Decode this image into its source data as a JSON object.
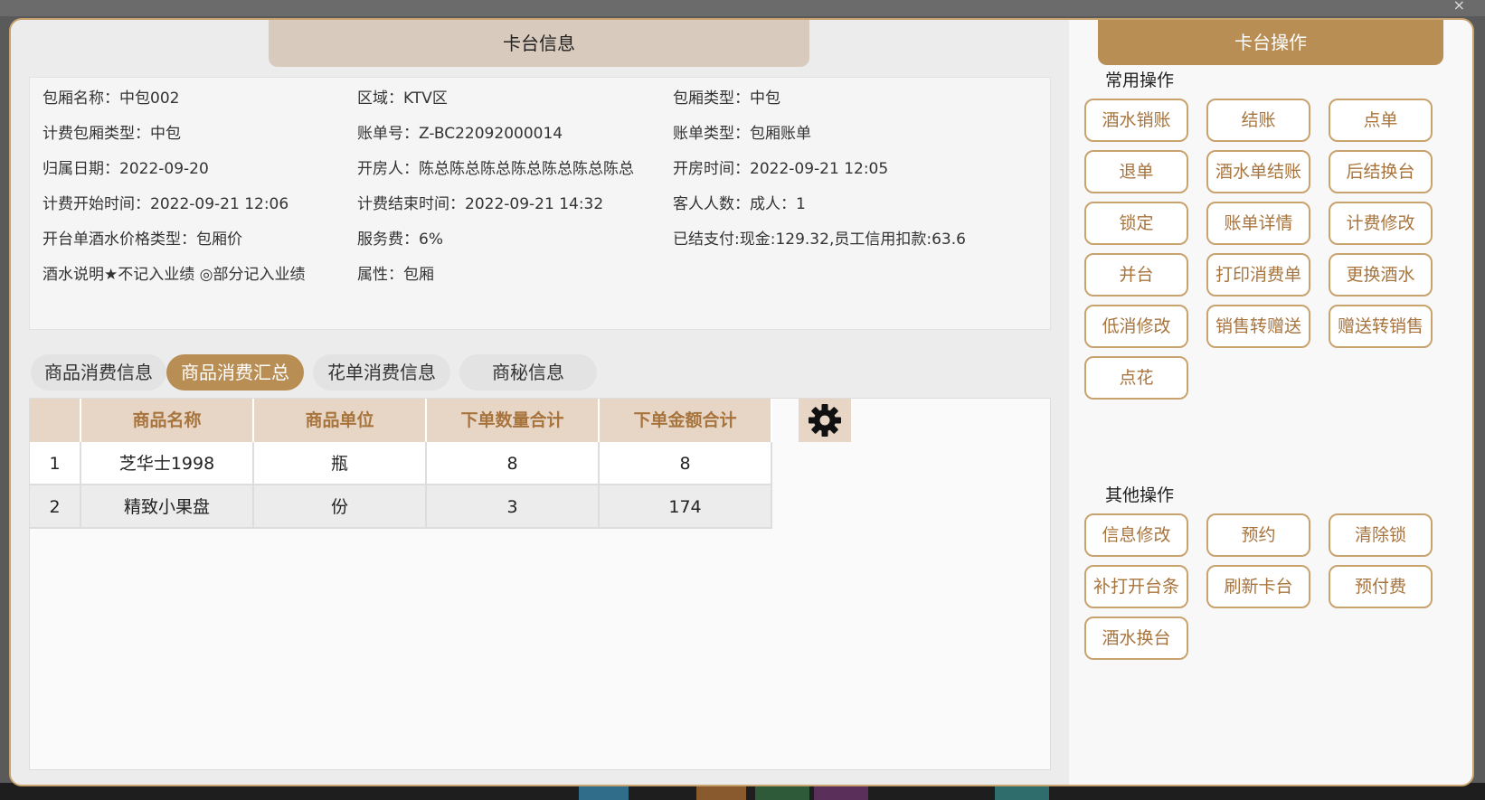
{
  "dialog": {
    "left_title": "卡台信息",
    "right_title": "卡台操作"
  },
  "info": [
    [
      "包厢名称：中包002",
      "区域：KTV区",
      "包厢类型：中包"
    ],
    [
      "计费包厢类型：中包",
      "账单号：Z-BC22092000014",
      "账单类型：包厢账单"
    ],
    [
      "归属日期：2022-09-20",
      "开房人：陈总陈总陈总陈总陈总陈总陈总",
      "开房时间：2022-09-21 12:05"
    ],
    [
      "计费开始时间：2022-09-21 12:06",
      "计费结束时间：2022-09-21 14:32",
      "客人人数：成人：1"
    ],
    [
      "开台单酒水价格类型：包厢价",
      "服务费：6%",
      "已结支付:现金:129.32,员工信用扣款:63.6"
    ],
    [
      "酒水说明★不记入业绩 ◎部分记入业绩",
      "属性：包厢",
      ""
    ]
  ],
  "tabs": [
    {
      "label": "商品消费信息",
      "active": false
    },
    {
      "label": "商品消费汇总",
      "active": true
    },
    {
      "label": "花单消费信息",
      "active": false
    },
    {
      "label": "商秘信息",
      "active": false
    }
  ],
  "table": {
    "headers": [
      "",
      "商品名称",
      "商品单位",
      "下单数量合计",
      "下单金额合计"
    ],
    "rows": [
      [
        "1",
        "芝华士1998",
        "瓶",
        "8",
        "8"
      ],
      [
        "2",
        "精致小果盘",
        "份",
        "3",
        "174"
      ]
    ]
  },
  "common_ops": {
    "title": "常用操作",
    "buttons": [
      "酒水销账",
      "结账",
      "点单",
      "退单",
      "酒水单结账",
      "后结换台",
      "锁定",
      "账单详情",
      "计费修改",
      "并台",
      "打印消费单",
      "更换酒水",
      "低消修改",
      "销售转赠送",
      "赠送转销售",
      "点花"
    ]
  },
  "other_ops": {
    "title": "其他操作",
    "buttons": [
      "信息修改",
      "预约",
      "清除锁",
      "补打开台条",
      "刷新卡台",
      "预付费",
      "酒水换台"
    ]
  },
  "colors": {
    "accent": "#b88e55",
    "accent_text": "#a8743d",
    "header_bg": "#e7d6c6"
  },
  "window": {
    "close_glyph": "×"
  }
}
